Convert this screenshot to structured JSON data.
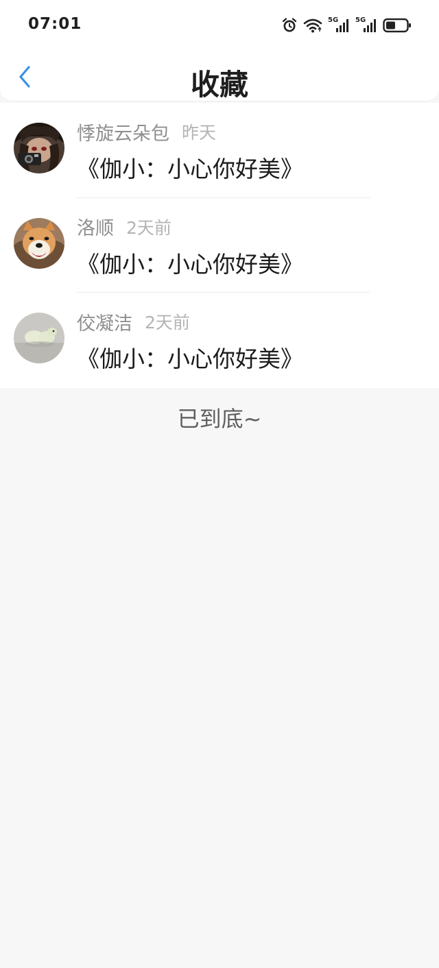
{
  "status_bar": {
    "time": "07:01",
    "icons": [
      "alarm-icon",
      "wifi-icon",
      "signal-5g-icon",
      "signal-5g-icon",
      "battery-icon"
    ],
    "network_label_1": "5G",
    "network_label_2": "5G"
  },
  "header": {
    "back_icon": "chevron-left-icon",
    "title": "收藏"
  },
  "favorites": [
    {
      "username": "悸旋云朵包",
      "time": "昨天",
      "title": "《伽小：小心你好美》",
      "avatar": "anime-avatar"
    },
    {
      "username": "洛顺",
      "time": "2天前",
      "title": "《伽小：小心你好美》",
      "avatar": "shiba-dog-avatar"
    },
    {
      "username": "佼凝洁",
      "time": "2天前",
      "title": "《伽小：小心你好美》",
      "avatar": "white-figurine-avatar"
    }
  ],
  "footer": {
    "end_text": "已到底~"
  },
  "colors": {
    "accent": "#3d8fe0",
    "background": "#f8f7f8",
    "username": "#8f8f8f",
    "time": "#b4b4b4"
  }
}
